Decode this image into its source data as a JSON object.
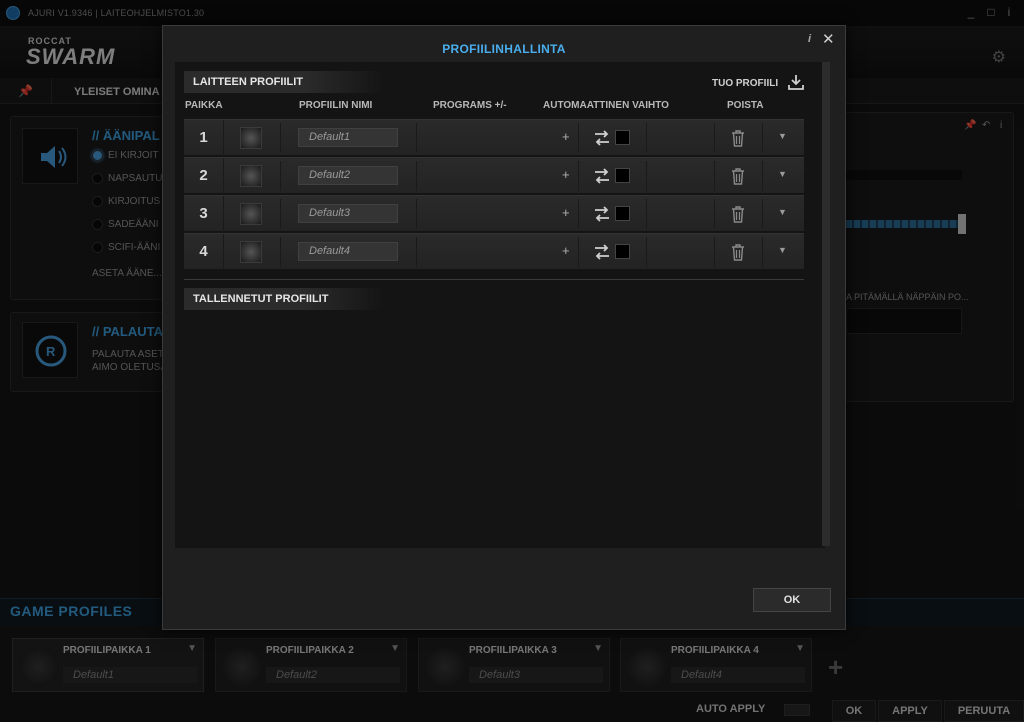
{
  "app": {
    "version_text": "AJURI V1.9346 | LAITEOHJELMISTO1.30",
    "brand_small": "ROCCAT",
    "brand_big": "SWARM",
    "window_buttons": [
      "_",
      "□",
      "i",
      "✕"
    ]
  },
  "background": {
    "general_tab": "YLEISET OMINA",
    "sound_panel": {
      "title": "// ÄÄNIPAL",
      "options": [
        "EI KIRJOIT",
        "NAPSAUTU",
        "KIRJOITUS",
        "SADEÄÄNI",
        "SCIFI-ÄÄNI"
      ],
      "selected_index": 0,
      "footer": "ASETA ÄÄNE..."
    },
    "restore_panel": {
      "title": "// PALAUTA",
      "line1": "PALAUTA ASET",
      "line2": "AIMO OLETUSA"
    },
    "right_panel_text": "A PITÄMÄLLÄ NÄPPÄIN PO...",
    "game_profiles": {
      "title": "GAME PROFILES",
      "slots": [
        {
          "label": "PROFIILIPAIKKA 1",
          "value": "Default1"
        },
        {
          "label": "PROFIILIPAIKKA 2",
          "value": "Default2"
        },
        {
          "label": "PROFIILIPAIKKA 3",
          "value": "Default3"
        },
        {
          "label": "PROFIILIPAIKKA 4",
          "value": "Default4"
        }
      ],
      "add_label": "+"
    },
    "bottom": {
      "auto_apply": "AUTO APPLY",
      "ok": "OK",
      "apply": "APPLY",
      "cancel": "PERUUTA"
    }
  },
  "modal": {
    "title": "PROFIILINHALLINTA",
    "info_label": "i",
    "close_label": "✕",
    "device_profiles_header": "LAITTEEN PROFIILIT",
    "import_label": "TUO PROFIILI",
    "columns": {
      "slot": "PAIKKA",
      "name": "PROFIILIN NIMI",
      "programs": "PROGRAMS +/-",
      "auto_switch": "AUTOMAATTINEN VAIHTO",
      "delete": "POISTA"
    },
    "rows": [
      {
        "slot": "1",
        "name": "Default1",
        "plus": "+",
        "chevron": "▼"
      },
      {
        "slot": "2",
        "name": "Default2",
        "plus": "+",
        "chevron": "▼"
      },
      {
        "slot": "3",
        "name": "Default3",
        "plus": "+",
        "chevron": "▼"
      },
      {
        "slot": "4",
        "name": "Default4",
        "plus": "+",
        "chevron": "▼"
      }
    ],
    "saved_profiles_header": "TALLENNETUT PROFIILIT",
    "ok_label": "OK"
  },
  "colors": {
    "accent": "#4aaeee",
    "background": "#151515",
    "modal": "#1f1f1f"
  }
}
